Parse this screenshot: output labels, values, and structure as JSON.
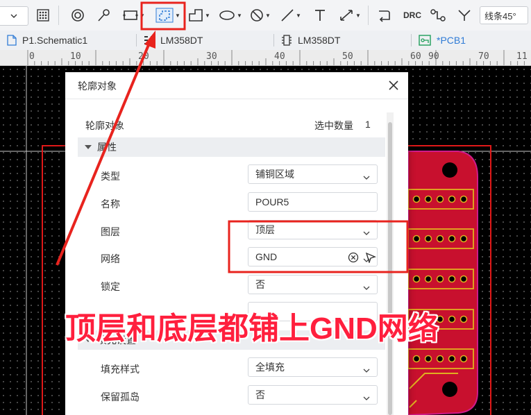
{
  "toolbar": {
    "line_mode_label": "线条45°",
    "drc_label": "DRC",
    "colors": {
      "highlight": "#e8231e",
      "active_tool": "#2f7bd6"
    }
  },
  "tabs": [
    {
      "label": "P1.Schematic1",
      "icon": "schematic-file-icon"
    },
    {
      "label": "LM358DT",
      "icon": "footprint-icon"
    },
    {
      "label": "LM358DT",
      "icon": "chip-icon"
    },
    {
      "label": "*PCB1",
      "icon": "pcb-file-icon"
    }
  ],
  "ruler": {
    "labels": [
      "0",
      "10",
      "20",
      "30",
      "40",
      "50",
      "60",
      "70",
      "80",
      "90",
      "10",
      "11"
    ]
  },
  "dialog": {
    "title": "轮廓对象",
    "object_label": "轮廓对象",
    "selected_count_label": "选中数量",
    "selected_count": "1",
    "properties_section": "属性",
    "fill_section": "填充设置",
    "fields": {
      "type": {
        "label": "类型",
        "value": "铺铜区域"
      },
      "name": {
        "label": "名称",
        "value": "POUR5"
      },
      "layer": {
        "label": "图层",
        "value": "顶层"
      },
      "net": {
        "label": "网络",
        "value": "GND"
      },
      "lock": {
        "label": "锁定",
        "value": "否"
      },
      "fill_style": {
        "label": "填充样式",
        "value": "全填充"
      },
      "keep_islands": {
        "label": "保留孤岛",
        "value": "否"
      }
    }
  },
  "annotation": {
    "text": "顶层和底层都铺上GND网络",
    "color": "#ff1f3d"
  }
}
